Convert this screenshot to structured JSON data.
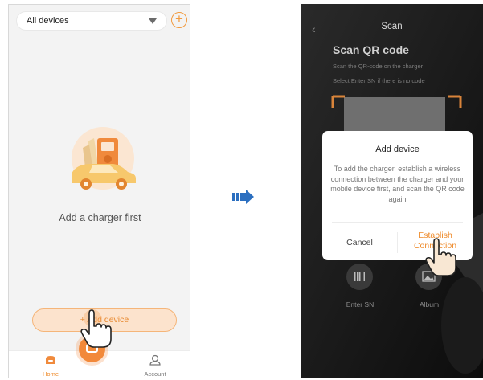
{
  "left_screen": {
    "device_filter": {
      "value": "All devices",
      "icon": "dropdown-caret-icon"
    },
    "add_icon": "plus-circle-icon",
    "empty_state": {
      "text": "Add a charger first"
    },
    "add_button_label": "+ Add device",
    "tabs": [
      {
        "label": "Home",
        "icon": "home-icon",
        "active": true
      },
      {
        "label": "Account",
        "icon": "user-icon",
        "active": false
      }
    ]
  },
  "right_screen": {
    "nav_title": "Scan",
    "heading": "Scan QR code",
    "subtext_1": "Scan the QR-code on the charger",
    "subtext_2": "Select Enter SN if there is no code",
    "actions": [
      {
        "label": "Enter SN",
        "icon": "barcode-icon"
      },
      {
        "label": "Album",
        "icon": "image-icon"
      }
    ],
    "dialog": {
      "title": "Add device",
      "body": "To add the charger, establish a wireless connection between the charger and your mobile device first, and scan the QR code again",
      "cancel_label": "Cancel",
      "confirm_label": "Establish Connection"
    }
  },
  "colors": {
    "accent": "#F2893A",
    "arrow": "#2B6FC0"
  }
}
